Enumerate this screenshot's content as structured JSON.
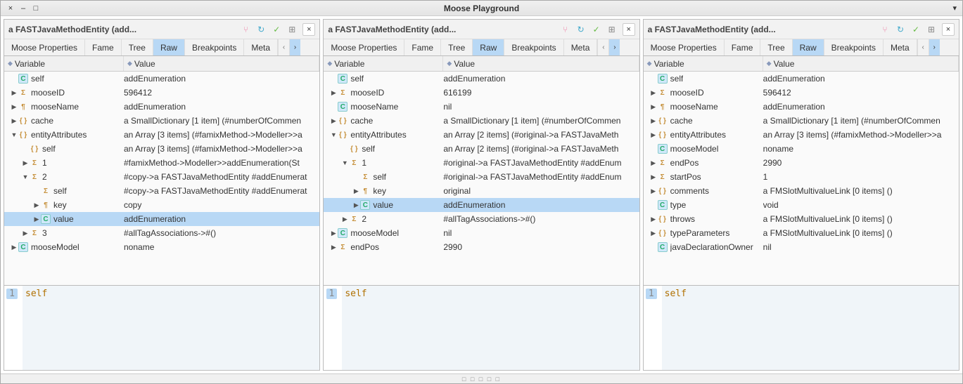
{
  "titlebar": {
    "title": "Moose Playground",
    "close": "×",
    "min": "–",
    "max": "□",
    "menu": "▾"
  },
  "statusbar": "□ □ □ □ □",
  "tabs": [
    "Moose Properties",
    "Fame",
    "Tree",
    "Raw",
    "Breakpoints",
    "Meta"
  ],
  "head": {
    "variable": "Variable",
    "value": "Value"
  },
  "code": {
    "line": "1",
    "text": "self"
  },
  "panes": [
    {
      "title": "a FASTJavaMethodEntity (add...",
      "rows": [
        {
          "d": 0,
          "e": "",
          "i": "C",
          "k": "self",
          "v": "addEnumeration"
        },
        {
          "d": 0,
          "e": "▶",
          "i": "S",
          "k": "mooseID",
          "v": "596412",
          "u": true
        },
        {
          "d": 0,
          "e": "▶",
          "i": "P",
          "k": "mooseName",
          "v": "addEnumeration"
        },
        {
          "d": 0,
          "e": "▶",
          "i": "B",
          "k": "cache",
          "v": "a SmallDictionary [1 item] (#numberOfCommen"
        },
        {
          "d": 0,
          "e": "▼",
          "i": "B",
          "k": "entityAttributes",
          "v": "an Array [3 items] (#famixMethod->Modeller>>a"
        },
        {
          "d": 1,
          "e": "",
          "i": "B",
          "k": "self",
          "v": "an Array [3 items] (#famixMethod->Modeller>>a"
        },
        {
          "d": 1,
          "e": "▶",
          "i": "S",
          "k": "1",
          "v": "#famixMethod->Modeller>>addEnumeration(St"
        },
        {
          "d": 1,
          "e": "▼",
          "i": "S",
          "k": "2",
          "v": "#copy->a FASTJavaMethodEntity #addEnumerat"
        },
        {
          "d": 2,
          "e": "",
          "i": "S",
          "k": "self",
          "v": "#copy->a FASTJavaMethodEntity #addEnumerat"
        },
        {
          "d": 2,
          "e": "▶",
          "i": "P",
          "k": "key",
          "v": "copy"
        },
        {
          "d": 2,
          "e": "▶",
          "i": "C",
          "k": "value",
          "v": "addEnumeration",
          "sel": true
        },
        {
          "d": 1,
          "e": "▶",
          "i": "S",
          "k": "3",
          "v": "#allTagAssociations->#()"
        },
        {
          "d": 0,
          "e": "▶",
          "i": "C",
          "k": "mooseModel",
          "v": "noname"
        }
      ]
    },
    {
      "title": "a FASTJavaMethodEntity (add...",
      "rows": [
        {
          "d": 0,
          "e": "",
          "i": "C",
          "k": "self",
          "v": "addEnumeration"
        },
        {
          "d": 0,
          "e": "▶",
          "i": "S",
          "k": "mooseID",
          "v": "616199",
          "u": true
        },
        {
          "d": 0,
          "e": "",
          "i": "C",
          "k": "mooseName",
          "v": "nil"
        },
        {
          "d": 0,
          "e": "▶",
          "i": "B",
          "k": "cache",
          "v": "a SmallDictionary [1 item] (#numberOfCommen"
        },
        {
          "d": 0,
          "e": "▼",
          "i": "B",
          "k": "entityAttributes",
          "v": "an Array [2 items] (#original->a FASTJavaMeth"
        },
        {
          "d": 1,
          "e": "",
          "i": "B",
          "k": "self",
          "v": "an Array [2 items] (#original->a FASTJavaMeth"
        },
        {
          "d": 1,
          "e": "▼",
          "i": "S",
          "k": "1",
          "v": "#original->a FASTJavaMethodEntity #addEnum"
        },
        {
          "d": 2,
          "e": "",
          "i": "S",
          "k": "self",
          "v": "#original->a FASTJavaMethodEntity #addEnum"
        },
        {
          "d": 2,
          "e": "▶",
          "i": "P",
          "k": "key",
          "v": "original"
        },
        {
          "d": 2,
          "e": "▶",
          "i": "C",
          "k": "value",
          "v": "addEnumeration",
          "sel": true
        },
        {
          "d": 1,
          "e": "▶",
          "i": "S",
          "k": "2",
          "v": "#allTagAssociations->#()"
        },
        {
          "d": 0,
          "e": "▶",
          "i": "C",
          "k": "mooseModel",
          "v": "nil"
        },
        {
          "d": 0,
          "e": "▶",
          "i": "S",
          "k": "endPos",
          "v": "2990"
        }
      ]
    },
    {
      "title": "a FASTJavaMethodEntity (add...",
      "rows": [
        {
          "d": 0,
          "e": "",
          "i": "C",
          "k": "self",
          "v": "addEnumeration"
        },
        {
          "d": 0,
          "e": "▶",
          "i": "S",
          "k": "mooseID",
          "v": "596412",
          "u": true
        },
        {
          "d": 0,
          "e": "▶",
          "i": "P",
          "k": "mooseName",
          "v": "addEnumeration"
        },
        {
          "d": 0,
          "e": "▶",
          "i": "B",
          "k": "cache",
          "v": "a SmallDictionary [1 item] (#numberOfCommen"
        },
        {
          "d": 0,
          "e": "▶",
          "i": "B",
          "k": "entityAttributes",
          "v": "an Array [3 items] (#famixMethod->Modeller>>a"
        },
        {
          "d": 0,
          "e": "",
          "i": "C",
          "k": "mooseModel",
          "v": "noname"
        },
        {
          "d": 0,
          "e": "▶",
          "i": "S",
          "k": "endPos",
          "v": "2990"
        },
        {
          "d": 0,
          "e": "▶",
          "i": "S",
          "k": "startPos",
          "v": "1"
        },
        {
          "d": 0,
          "e": "▶",
          "i": "B",
          "k": "comments",
          "v": "a FMSlotMultivalueLink [0 items] ()"
        },
        {
          "d": 0,
          "e": "",
          "i": "C",
          "k": "type",
          "v": "void"
        },
        {
          "d": 0,
          "e": "▶",
          "i": "B",
          "k": "throws",
          "v": "a FMSlotMultivalueLink [0 items] ()"
        },
        {
          "d": 0,
          "e": "▶",
          "i": "B",
          "k": "typeParameters",
          "v": "a FMSlotMultivalueLink [0 items] ()"
        },
        {
          "d": 0,
          "e": "",
          "i": "C",
          "k": "javaDeclarationOwner",
          "v": "nil"
        }
      ]
    }
  ],
  "toolicons": [
    {
      "name": "transmit-icon",
      "glyph": "⑂",
      "color": "#e8a"
    },
    {
      "name": "refresh-icon",
      "glyph": "↻",
      "color": "#4ac"
    },
    {
      "name": "accept-icon",
      "glyph": "✓",
      "color": "#6b4"
    },
    {
      "name": "table-icon",
      "glyph": "⊞",
      "color": "#888"
    }
  ]
}
